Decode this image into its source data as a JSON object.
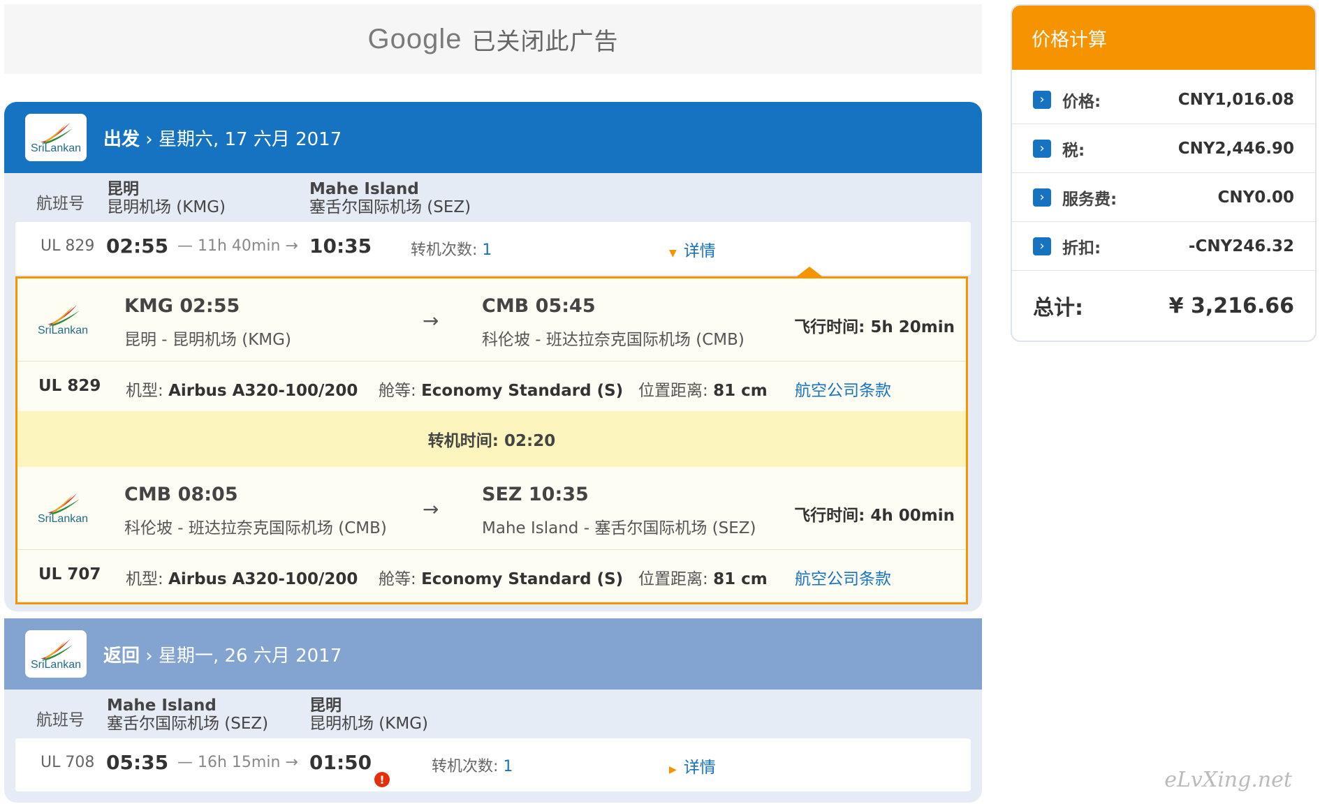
{
  "ad": {
    "brand": "Google",
    "text": "已关闭此广告"
  },
  "outbound": {
    "direction": "出发",
    "date": "星期六, 17 六月 2017",
    "airline_logo": "SriLankan",
    "hdr_label": "航班号",
    "from_city": "昆明",
    "from_airport": "昆明机场 (KMG)",
    "to_city": "Mahe Island",
    "to_airport": "塞舌尔国际机场 (SEZ)",
    "flight_no": "UL 829",
    "dep_time": "02:55",
    "duration": "— 11h 40min →",
    "arr_time": "10:35",
    "stops_label": "转机次数:",
    "stops_value": "1",
    "details_label": "详情",
    "segments": [
      {
        "from_code": "KMG 02:55",
        "from_place": "昆明 - 昆明机场 (KMG)",
        "to_code": "CMB 05:45",
        "to_place": "科伦坡 - 班达拉奈克国际机场 (CMB)",
        "flight_time": "飞行时间: 5h 20min",
        "flight_no": "UL 829",
        "aircraft_label": "机型:",
        "aircraft": "Airbus A320-100/200",
        "class_label": "舱等:",
        "class": "Economy Standard (S)",
        "pitch_label": "位置距离:",
        "pitch": "81 cm",
        "terms": "航空公司条款"
      },
      {
        "from_code": "CMB 08:05",
        "from_place": "科伦坡 - 班达拉奈克国际机场 (CMB)",
        "to_code": "SEZ 10:35",
        "to_place": "Mahe Island - 塞舌尔国际机场 (SEZ)",
        "flight_time": "飞行时间: 4h 00min",
        "flight_no": "UL 707",
        "aircraft_label": "机型:",
        "aircraft": "Airbus A320-100/200",
        "class_label": "舱等:",
        "class": "Economy Standard (S)",
        "pitch_label": "位置距离:",
        "pitch": "81 cm",
        "terms": "航空公司条款"
      }
    ],
    "connection": "转机时间: 02:20",
    "arrow": "→"
  },
  "return": {
    "direction": "返回",
    "date": "星期一, 26 六月 2017",
    "airline_logo": "SriLankan",
    "hdr_label": "航班号",
    "from_city": "Mahe Island",
    "from_airport": "塞舌尔国际机场 (SEZ)",
    "to_city": "昆明",
    "to_airport": "昆明机场 (KMG)",
    "flight_no": "UL 708",
    "dep_time": "05:35",
    "duration": "— 16h 15min →",
    "arr_time": "01:50",
    "warning_icon": "!",
    "stops_label": "转机次数:",
    "stops_value": "1",
    "details_label": "详情"
  },
  "price": {
    "title": "价格计算",
    "rows": [
      {
        "label": "价格:",
        "value": "CNY1,016.08"
      },
      {
        "label": "税:",
        "value": "CNY2,446.90"
      },
      {
        "label": "服务费:",
        "value": "CNY0.00"
      },
      {
        "label": "折扣:",
        "value": "-CNY246.32"
      }
    ],
    "total_label": "总计:",
    "total_value": "¥ 3,216.66"
  },
  "watermark": "eLvXing.net",
  "colors": {
    "primary": "#1673c2",
    "accent": "#f59300",
    "return_band": "#83a3d0",
    "connection_bg": "#fcf6be"
  }
}
